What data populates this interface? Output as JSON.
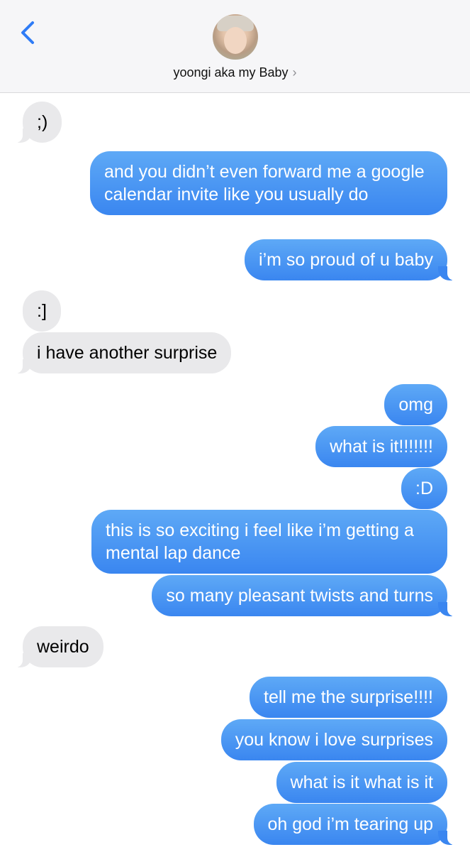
{
  "header": {
    "contact_name": "yoongi aka my Baby",
    "chevron": "›",
    "back_icon": "chevron-left-icon",
    "accent": "#2f7cf6"
  },
  "messages": [
    {
      "from": "them",
      "text": ";)"
    },
    {
      "from": "me",
      "text": "and you didn’t even forward me a google calendar invite like you usually do"
    },
    {
      "from": "me",
      "text": "i’m so proud of u baby"
    },
    {
      "from": "them",
      "text": ":]"
    },
    {
      "from": "them",
      "text": "i have another surprise"
    },
    {
      "from": "me",
      "text": "omg"
    },
    {
      "from": "me",
      "text": "what is it!!!!!!!"
    },
    {
      "from": "me",
      "text": ":D"
    },
    {
      "from": "me",
      "text": "this is so exciting i feel like i’m getting a mental lap dance"
    },
    {
      "from": "me",
      "text": "so many pleasant twists and turns"
    },
    {
      "from": "them",
      "text": "weirdo"
    },
    {
      "from": "me",
      "text": "tell me the surprise!!!!"
    },
    {
      "from": "me",
      "text": "you know i love surprises"
    },
    {
      "from": "me",
      "text": "what is it what is it"
    },
    {
      "from": "me",
      "text": "oh god i’m tearing up"
    }
  ],
  "colors": {
    "incoming_bubble": "#e9e9eb",
    "outgoing_bubble": "#3a86f0",
    "header_bg": "#f6f6f8"
  }
}
